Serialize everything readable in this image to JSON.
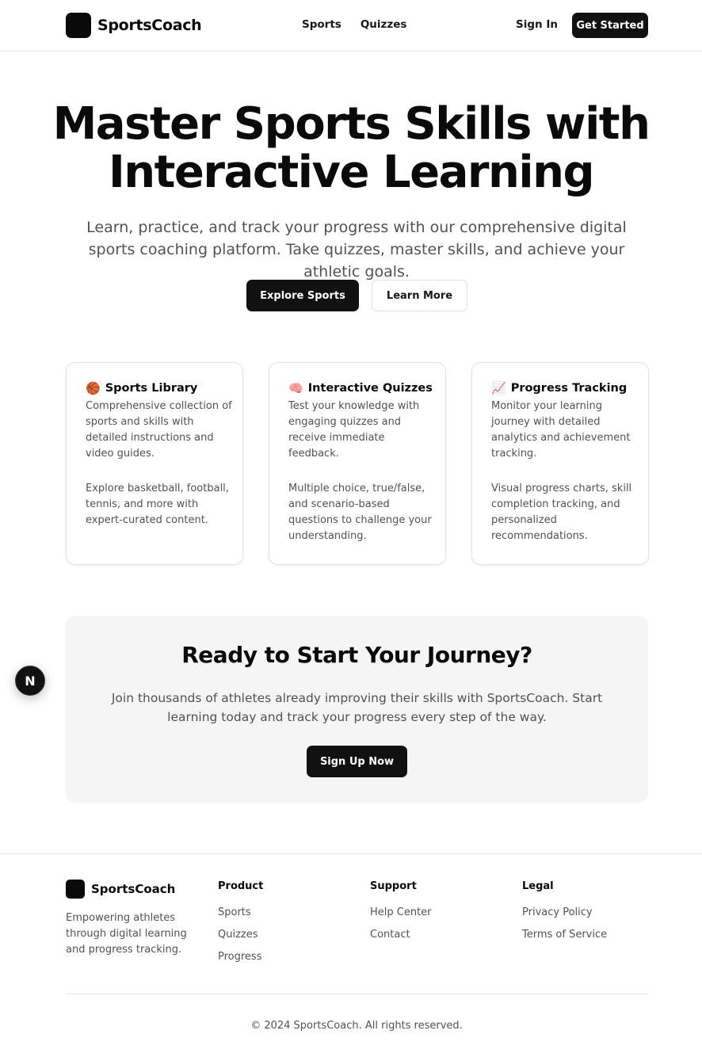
{
  "header": {
    "brand": "SportsCoach",
    "nav": [
      {
        "label": "Sports"
      },
      {
        "label": "Quizzes"
      }
    ],
    "sign_in": "Sign In",
    "get_started": "Get Started"
  },
  "hero": {
    "title_line1": "Master Sports Skills with",
    "title_line2": "Interactive Learning",
    "subtitle": "Learn, practice, and track your progress with our comprehensive digital sports coaching platform. Take quizzes, master skills, and achieve your athletic goals.",
    "primary_button": "Explore Sports",
    "secondary_button": "Learn More"
  },
  "features": [
    {
      "icon": "basketball-icon",
      "emoji": "🏀",
      "title": "Sports Library",
      "description": "Comprehensive collection of sports and skills with detailed instructions and video guides.",
      "detail": "Explore basketball, football, tennis, and more with expert-curated content."
    },
    {
      "icon": "brain-icon",
      "emoji": "🧠",
      "title": "Interactive Quizzes",
      "description": "Test your knowledge with engaging quizzes and receive immediate feedback.",
      "detail": "Multiple choice, true/false, and scenario-based questions to challenge your understanding."
    },
    {
      "icon": "chart-increasing-icon",
      "emoji": "📈",
      "title": "Progress Tracking",
      "description": "Monitor your learning journey with detailed analytics and achievement tracking.",
      "detail": "Visual progress charts, skill completion tracking, and personalized recommendations."
    }
  ],
  "cta": {
    "title": "Ready to Start Your Journey?",
    "text": "Join thousands of athletes already improving their skills with SportsCoach. Start learning today and track your progress every step of the way.",
    "button": "Sign Up Now"
  },
  "fab": {
    "label": "N"
  },
  "footer": {
    "brand": "SportsCoach",
    "tagline": "Empowering athletes through digital learning and progress tracking.",
    "columns": [
      {
        "title": "Product",
        "links": [
          "Sports",
          "Quizzes",
          "Progress"
        ]
      },
      {
        "title": "Support",
        "links": [
          "Help Center",
          "Contact"
        ]
      },
      {
        "title": "Legal",
        "links": [
          "Privacy Policy",
          "Terms of Service"
        ]
      }
    ],
    "copyright": "© 2024 SportsCoach. All rights reserved."
  },
  "colors": {
    "primary": "#111111",
    "text": "#0a0a0a",
    "muted": "#525252",
    "border": "#e5e5e5",
    "cta_bg": "#f5f5f5"
  }
}
